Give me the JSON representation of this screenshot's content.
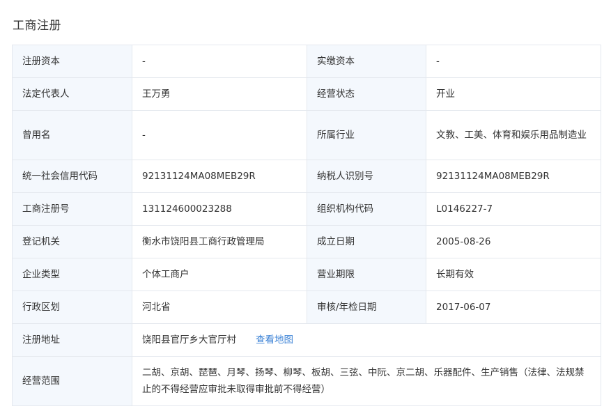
{
  "section": {
    "title": "工商注册"
  },
  "rows": [
    {
      "label1": "注册资本",
      "value1": "-",
      "label2": "实缴资本",
      "value2": "-"
    },
    {
      "label1": "法定代表人",
      "value1": "王万勇",
      "label2": "经营状态",
      "value2": "开业"
    },
    {
      "label1": "曾用名",
      "value1": "-",
      "label2": "所属行业",
      "value2": "文教、工美、体育和娱乐用品制造业"
    },
    {
      "label1": "统一社会信用代码",
      "value1": "92131124MA08MEB29R",
      "label2": "纳税人识别号",
      "value2": "92131124MA08MEB29R"
    },
    {
      "label1": "工商注册号",
      "value1": "131124600023288",
      "label2": "组织机构代码",
      "value2": "L0146227-7"
    },
    {
      "label1": "登记机关",
      "value1": "衡水市饶阳县工商行政管理局",
      "label2": "成立日期",
      "value2": "2005-08-26"
    },
    {
      "label1": "企业类型",
      "value1": "个体工商户",
      "label2": "营业期限",
      "value2": "长期有效"
    },
    {
      "label1": "行政区划",
      "value1": "河北省",
      "label2": "审核/年检日期",
      "value2": "2017-06-07"
    }
  ],
  "address": {
    "label": "注册地址",
    "value": "饶阳县官厅乡大官厅村",
    "map_link": "查看地图"
  },
  "scope": {
    "label": "经营范围",
    "value": "二胡、京胡、琵琶、月琴、扬琴、柳琴、板胡、三弦、中阮、京二胡、乐器配件、生产销售（法律、法规禁止的不得经营应审批未取得审批前不得经营）"
  }
}
